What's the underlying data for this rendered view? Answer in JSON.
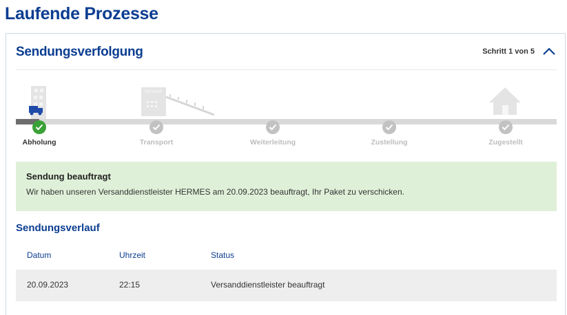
{
  "page": {
    "title": "Laufende Prozesse"
  },
  "card": {
    "title": "Sendungsverfolgung",
    "step_counter": "Schritt 1 von 5",
    "collapse_icon": "chevron-up-icon"
  },
  "tracker": {
    "illustration_sign": "Versand",
    "steps": [
      {
        "label": "Abholung",
        "state": "done"
      },
      {
        "label": "Transport",
        "state": "pending"
      },
      {
        "label": "Weiterleitung",
        "state": "pending"
      },
      {
        "label": "Zustellung",
        "state": "pending"
      },
      {
        "label": "Zugestellt",
        "state": "pending"
      }
    ],
    "current_step": 1,
    "total_steps": 5
  },
  "status": {
    "title": "Sendung beauftragt",
    "text": "Wir haben unseren Versanddienstleister HERMES am 20.09.2023 beauftragt, Ihr Paket zu verschicken."
  },
  "history": {
    "title": "Sendungsverlauf",
    "columns": [
      "Datum",
      "Uhrzeit",
      "Status"
    ],
    "rows": [
      {
        "date": "20.09.2023",
        "time": "22:15",
        "status": "Versanddienstleister beauftragt"
      }
    ]
  },
  "colors": {
    "brand_blue": "#0b3d91",
    "success_green": "#3aa137",
    "status_bg": "#dff0d8",
    "inactive_gray": "#c2c2c2"
  }
}
